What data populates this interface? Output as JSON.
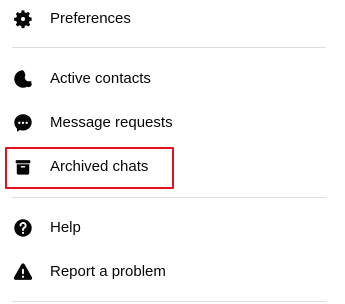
{
  "menu": {
    "items": [
      {
        "id": "preferences",
        "label": "Preferences",
        "icon": "gear-icon"
      },
      {
        "id": "active-contacts",
        "label": "Active contacts",
        "icon": "active-contacts-icon"
      },
      {
        "id": "message-requests",
        "label": "Message requests",
        "icon": "chat-bubble-icon"
      },
      {
        "id": "archived-chats",
        "label": "Archived chats",
        "icon": "archive-box-icon",
        "highlighted": true
      },
      {
        "id": "help",
        "label": "Help",
        "icon": "question-icon"
      },
      {
        "id": "report-problem",
        "label": "Report a problem",
        "icon": "warning-icon"
      }
    ]
  },
  "colors": {
    "text": "#050505",
    "icon": "#050505",
    "divider": "#dadde1",
    "highlight_border": "#e0101c",
    "background": "#ffffff"
  }
}
